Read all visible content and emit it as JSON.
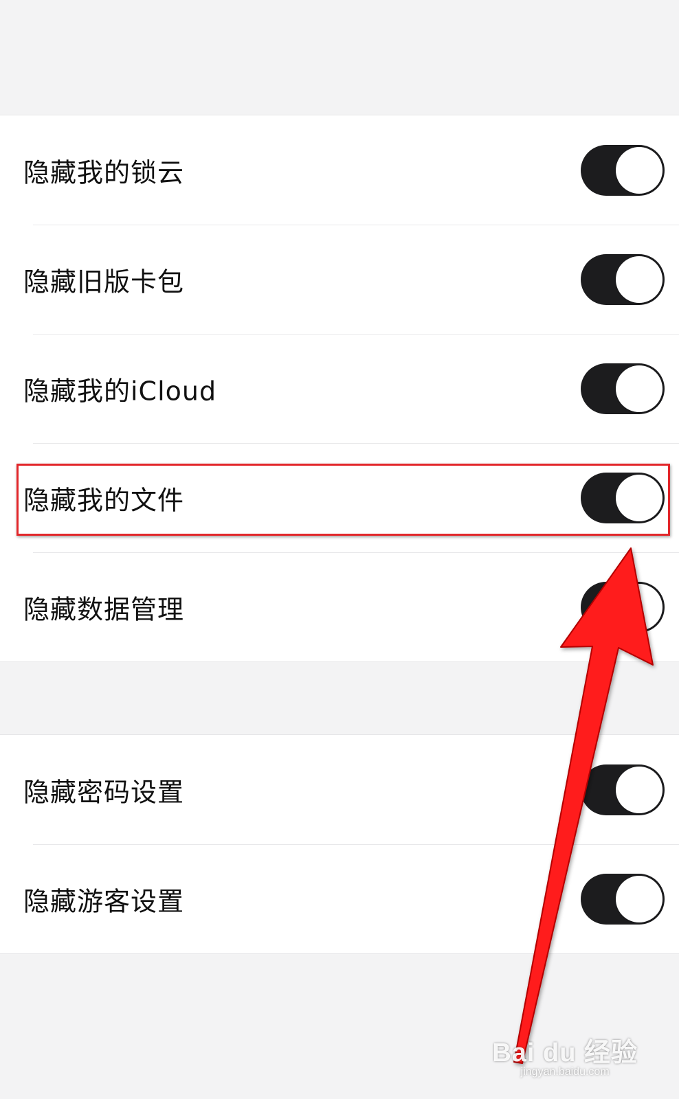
{
  "settings": {
    "group1": [
      {
        "label": "隐藏我的锁云",
        "on": true
      },
      {
        "label": "隐藏旧版卡包",
        "on": true
      },
      {
        "label": "隐藏我的iCloud",
        "on": true
      },
      {
        "label": "隐藏我的文件",
        "on": true
      },
      {
        "label": "隐藏数据管理",
        "on": true
      }
    ],
    "group2": [
      {
        "label": "隐藏密码设置",
        "on": true
      },
      {
        "label": "隐藏游客设置",
        "on": true
      }
    ]
  },
  "annotation": {
    "highlight_color": "#e2262a",
    "arrow_color": "#ff1a1a",
    "highlighted_row": "隐藏我的文件"
  },
  "watermark": {
    "logo": "Bai du 经验",
    "url": "jingyan.baidu.com"
  },
  "colors": {
    "background": "#f3f3f4",
    "toggle_on": "#1c1c1e",
    "row_bg": "#ffffff"
  }
}
